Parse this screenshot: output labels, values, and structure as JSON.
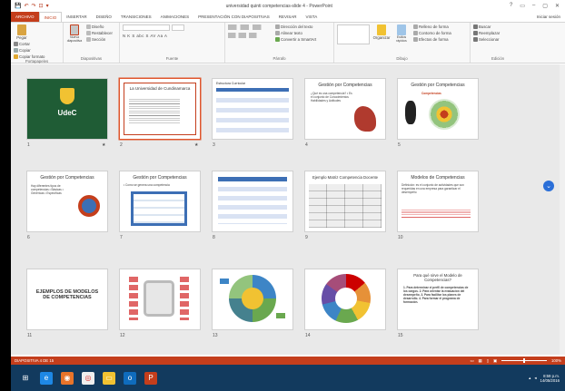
{
  "window": {
    "title": "universidad quinti competencias-slide 4 - PowerPoint",
    "controls": [
      "?",
      "▭",
      "–",
      "▢",
      "✕"
    ]
  },
  "quick_access": [
    "💾",
    "↶",
    "↷",
    "⊡",
    "▾"
  ],
  "tabs": {
    "file": "ARCHIVO",
    "items": [
      "INICIO",
      "INSERTAR",
      "DISEÑO",
      "TRANSICIONES",
      "ANIMACIONES",
      "PRESENTACIÓN CON DIAPOSITIVAS",
      "REVISAR",
      "VISTA"
    ],
    "active": "INICIO",
    "user": "Iniciar sesión"
  },
  "ribbon": {
    "portapapeles": {
      "label": "Portapapeles",
      "pegar": "Pegar",
      "cortar": "Cortar",
      "copiar": "Copiar",
      "copiar_formato": "Copiar formato"
    },
    "diapositivas": {
      "label": "Diapositivas",
      "nueva": "Nueva diapositiva",
      "diseno": "Diseño",
      "restablecer": "Restablecer",
      "seccion": "Sección"
    },
    "fuente": {
      "label": "Fuente",
      "format": "N  K  S  abc  S  AV  Aa  A"
    },
    "parrafo": {
      "label": "Párrafo",
      "direccion": "Dirección del texto",
      "alinear": "Alinear texto",
      "smartart": "Convertir a SmartArt"
    },
    "dibujo": {
      "label": "Dibujo",
      "organizar": "Organizar",
      "estilos": "Estilos rápidos",
      "relleno": "Relleno de forma",
      "contorno": "Contorno de forma",
      "efectos": "Efectos de forma"
    },
    "edicion": {
      "label": "Edición",
      "buscar": "Buscar",
      "reemplazar": "Reemplazar",
      "seleccionar": "Seleccionar"
    }
  },
  "slides": [
    {
      "num": "1",
      "star": "★",
      "title": "UdeC"
    },
    {
      "num": "2",
      "star": "★",
      "title": "La Universidad de Cundinamarca"
    },
    {
      "num": "3",
      "title": "Estructura Curricular"
    },
    {
      "num": "4",
      "title": "Gestión por Competencias",
      "body": "¿Qué es una competencia?  • Es el conjunto de Conocimientos Habilidades y Actitudes"
    },
    {
      "num": "5",
      "title": "Gestión por Competencias",
      "body": "Competencias"
    },
    {
      "num": "6",
      "title": "Gestión por Competencias",
      "body": "Hay diferentes tipos de competencias • Básicas • Genéricas • Específicas"
    },
    {
      "num": "7",
      "title": "Gestión por Competencias",
      "body": "• Como se genera una competencia"
    },
    {
      "num": "8",
      "title": ""
    },
    {
      "num": "9",
      "title": "Ejemplo Matriz Competencia Docente"
    },
    {
      "num": "10",
      "title": "Modelos de Competencias",
      "body": "Definición: es el conjunto de actividades que son requeridas en una empresa para garantizar el desempeño"
    },
    {
      "num": "11",
      "title": "EJEMPLOS DE MODELOS DE COMPETENCIAS"
    },
    {
      "num": "12",
      "title": ""
    },
    {
      "num": "13",
      "title": ""
    },
    {
      "num": "14",
      "title": ""
    },
    {
      "num": "15",
      "title": "Para qué sirve el Modelo de Competencias?",
      "body": "1. Para determinar el perfil de competencias de los cargos. 2. Para orientar la evaluación del desempeño. 3. Para facilitar los planes de desarrollo. 4. Para formar el programa de formación."
    }
  ],
  "status": {
    "left": "DIAPOSITIVA 4 DE 15",
    "zoom": "100%"
  },
  "taskbar": {
    "time": "8:59 p.m.",
    "date": "14/05/2016"
  },
  "colors": {
    "accent": "#c43e1c",
    "taskbar": "#123a5e"
  }
}
